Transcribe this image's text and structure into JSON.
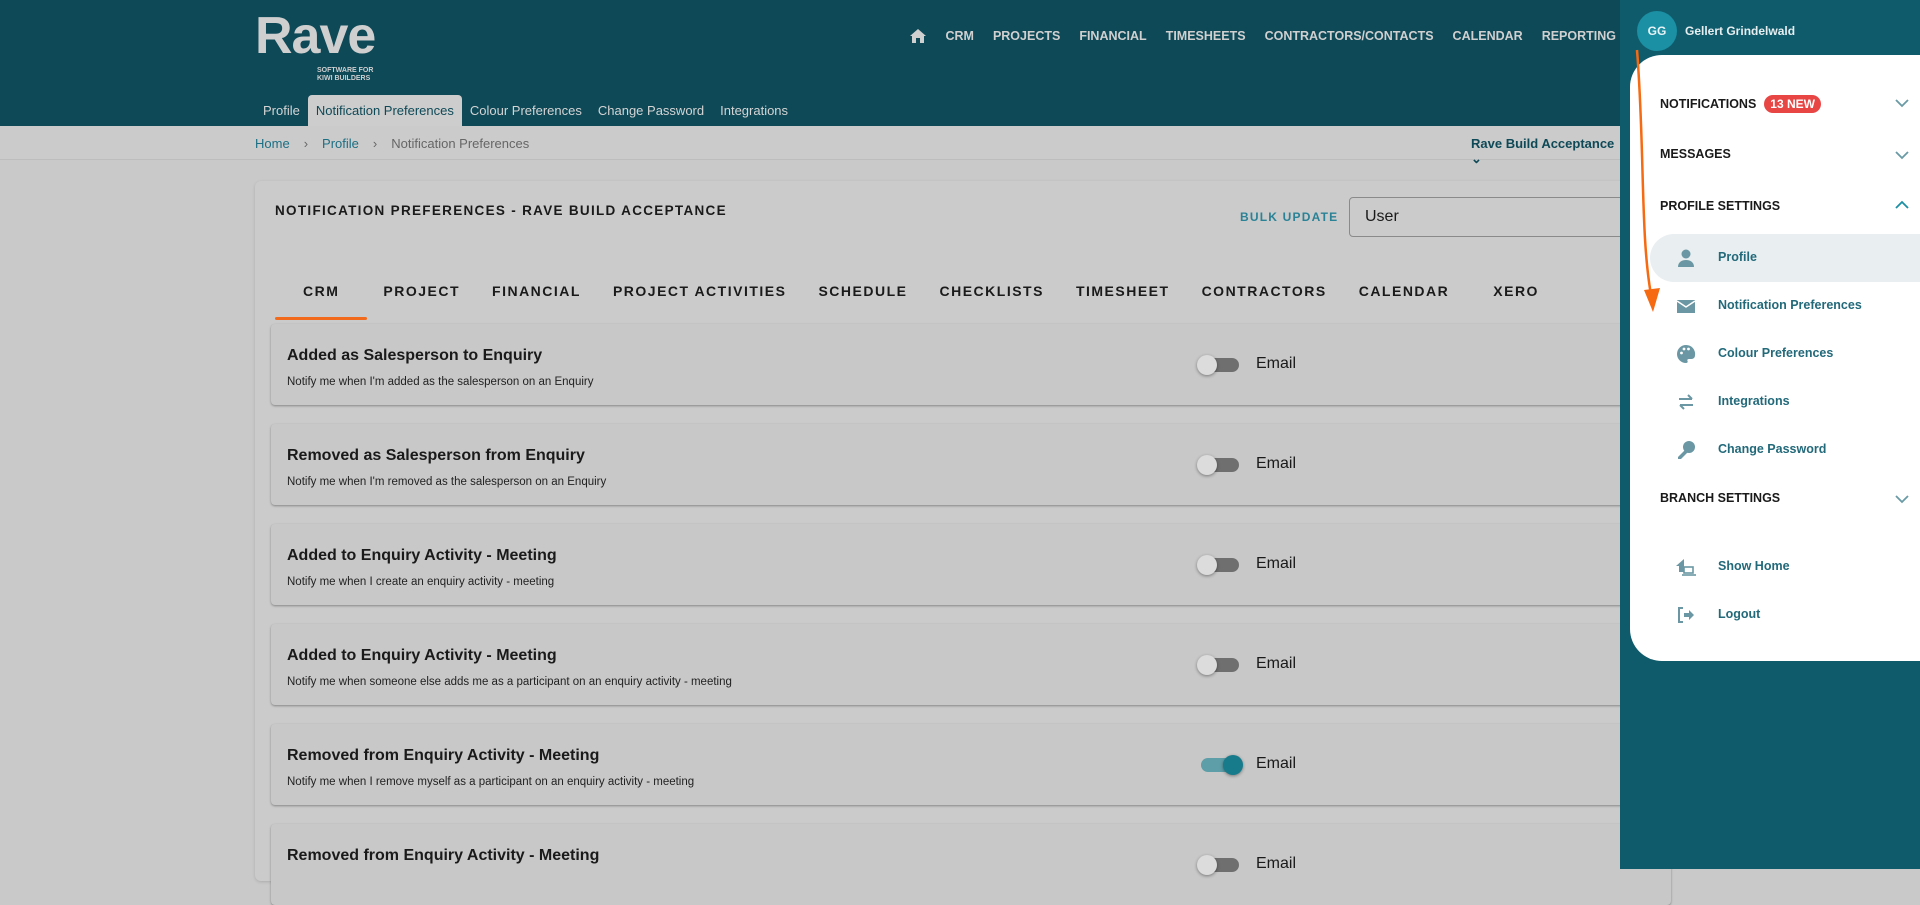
{
  "header": {
    "logo": "Rave",
    "logo_tagline": "SOFTWARE FOR KIWI BUILDERS",
    "nav": [
      "CRM",
      "PROJECTS",
      "FINANCIAL",
      "TIMESHEETS",
      "CONTRACTORS/CONTACTS",
      "CALENDAR",
      "REPORTING"
    ],
    "subtabs": [
      "Profile",
      "Notification Preferences",
      "Colour Preferences",
      "Change Password",
      "Integrations"
    ]
  },
  "breadcrumb": [
    "Home",
    "Profile",
    "Notification Preferences"
  ],
  "branch_selector": "Rave Build Acceptance",
  "card": {
    "title": "NOTIFICATION PREFERENCES - RAVE BUILD ACCEPTANCE",
    "bulk_update": "BULK UPDATE",
    "bulk_select_value": "User",
    "tabs": [
      "CRM",
      "PROJECT",
      "FINANCIAL",
      "PROJECT ACTIVITIES",
      "SCHEDULE",
      "CHECKLISTS",
      "TIMESHEET",
      "CONTRACTORS",
      "CALENDAR",
      "XERO"
    ],
    "rows": [
      {
        "title": "Added as Salesperson to Enquiry",
        "desc": "Notify me when I'm added as the salesperson on an Enquiry",
        "channel": "Email",
        "enabled": false
      },
      {
        "title": "Removed as Salesperson from Enquiry",
        "desc": "Notify me when I'm removed as the salesperson on an Enquiry",
        "channel": "Email",
        "enabled": false
      },
      {
        "title": "Added to Enquiry Activity - Meeting",
        "desc": "Notify me when I create an enquiry activity - meeting",
        "channel": "Email",
        "enabled": false
      },
      {
        "title": "Added to Enquiry Activity - Meeting",
        "desc": "Notify me when someone else adds me as a participant on an enquiry activity - meeting",
        "channel": "Email",
        "enabled": false
      },
      {
        "title": "Removed from Enquiry Activity - Meeting",
        "desc": "Notify me when I remove myself as a participant on an enquiry activity - meeting",
        "channel": "Email",
        "enabled": true
      },
      {
        "title": "Removed from Enquiry Activity - Meeting",
        "desc": "",
        "channel": "Email",
        "enabled": false
      }
    ]
  },
  "user": {
    "initials": "GG",
    "name": "Gellert Grindelwald"
  },
  "menu": {
    "notifications": "NOTIFICATIONS",
    "notifications_badge": "13 NEW",
    "messages": "MESSAGES",
    "profile_settings": "PROFILE SETTINGS",
    "profile_items": [
      "Profile",
      "Notification Preferences",
      "Colour Preferences",
      "Integrations",
      "Change Password"
    ],
    "branch_settings": "BRANCH SETTINGS",
    "show_home": "Show Home",
    "logout": "Logout"
  },
  "colors": {
    "header": "#0e4957",
    "accent": "#f26b1d",
    "teal": "#177b8c",
    "badge": "#e84545"
  }
}
